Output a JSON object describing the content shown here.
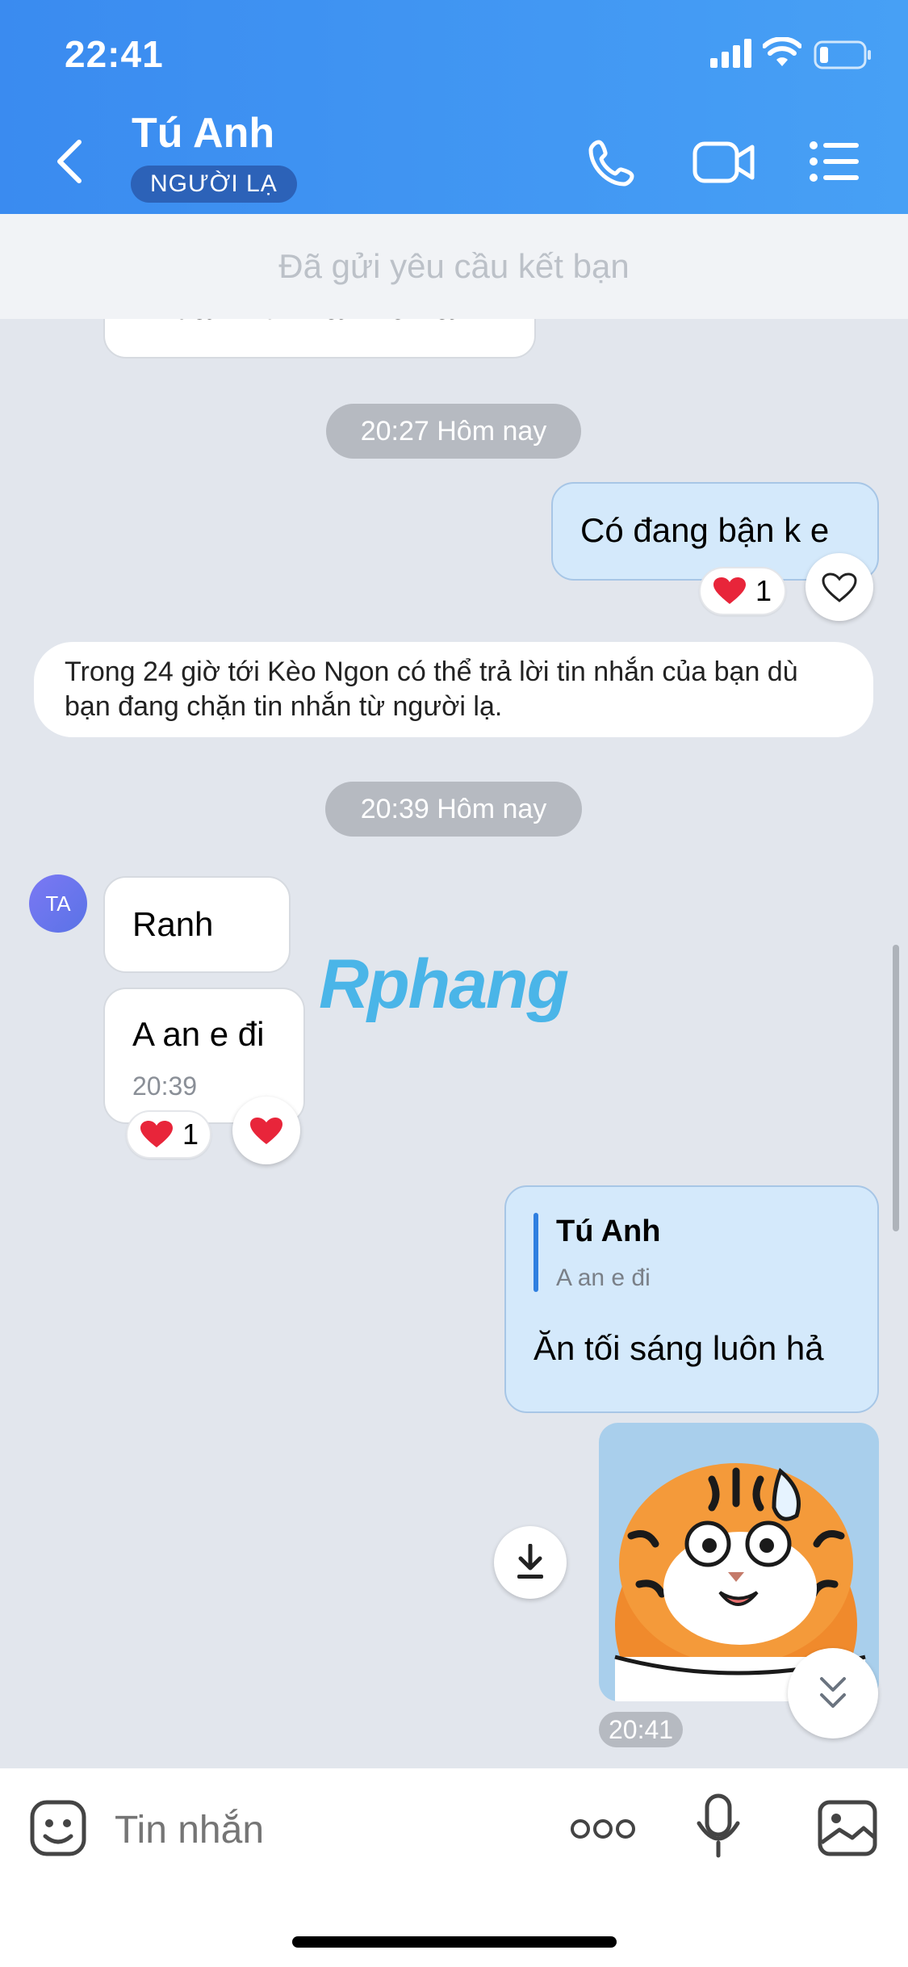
{
  "status_bar": {
    "time": "22:41"
  },
  "header": {
    "title": "Tú Anh",
    "badge": "NGƯỜI LẠ"
  },
  "friend_request": {
    "label": "Đã gửi yêu cầu kết bạn"
  },
  "messages": {
    "partial_text": "Đi đám rồi mai mới làm",
    "stamp1": "20:27 Hôm nay",
    "out1": "Có đang bận k e",
    "out1_reaction_count": "1",
    "notice": "Trong 24 giờ tới Kèo Ngon có thể trả lời tin nhắn của bạn dù bạn đang chặn tin nhắn từ người lạ.",
    "stamp2": "20:39 Hôm nay",
    "avatar_initials": "TA",
    "in1": "Ranh",
    "in2": "A an e đi",
    "in2_time": "20:39",
    "in2_reaction_count": "1",
    "reply_name": "Tú Anh",
    "reply_quote": "A an e đi",
    "out2": "Ăn tối sáng luôn hả",
    "sticker_time": "20:41"
  },
  "watermark": "Rphang",
  "composer": {
    "placeholder": "Tin nhắn"
  },
  "icons": {
    "back": "chevron-left-icon",
    "call": "phone-icon",
    "video": "video-camera-icon",
    "menu": "list-icon",
    "heart": "heart-icon",
    "download": "download-icon",
    "scroll_down": "double-chevron-down-icon",
    "emoji": "sticker-icon",
    "more": "more-dots-icon",
    "mic": "microphone-icon",
    "gallery": "image-icon"
  },
  "colors": {
    "header": "#3a8bf0",
    "outgoing": "#d4e9fb",
    "heart": "#e8253a"
  }
}
